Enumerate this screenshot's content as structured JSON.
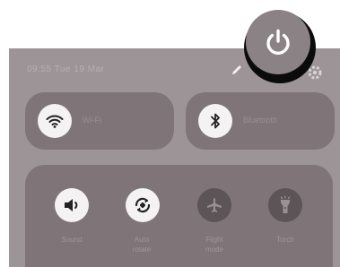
{
  "status_bar": {
    "time_date": "09:55 Tue 19 Mar"
  },
  "tiles": {
    "wifi": {
      "label": "Wi-Fi",
      "icon": "wifi-icon"
    },
    "bluetooth": {
      "label": "Bluetooth",
      "icon": "bluetooth-icon"
    }
  },
  "quick_toggles": [
    {
      "label": "Sound",
      "icon": "speaker-icon",
      "state": "on"
    },
    {
      "label": "Auto\nrotate",
      "icon": "auto-rotate-icon",
      "state": "on"
    },
    {
      "label": "Flight\nmode",
      "icon": "airplane-icon",
      "state": "off"
    },
    {
      "label": "Torch",
      "icon": "flashlight-icon",
      "state": "off"
    }
  ],
  "header_icons": {
    "edit": "pencil-icon",
    "settings": "gear-icon",
    "power": "power-icon"
  },
  "colors": {
    "panel": "#9c9496",
    "tile": "#7f7578",
    "active_circle": "#f4f2f3",
    "inactive_circle": "#5d5457"
  }
}
